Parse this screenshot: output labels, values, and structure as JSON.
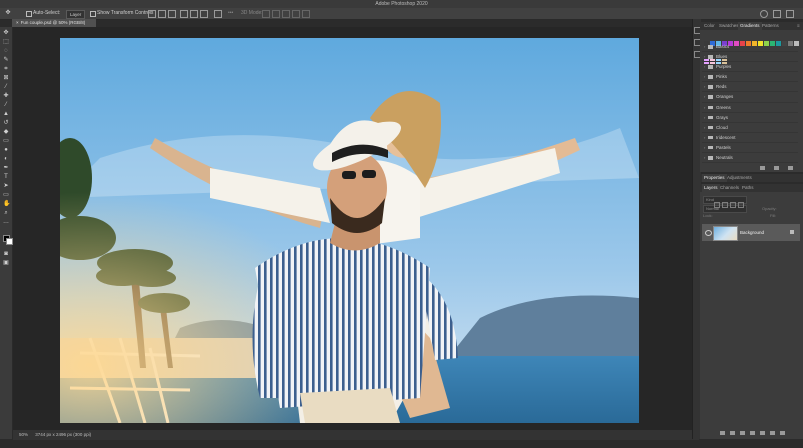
{
  "window": {
    "title": "Adobe Photoshop 2020",
    "traffic_lights": [
      "#ff5f57",
      "#febc2e",
      "#28c840"
    ]
  },
  "options_bar": {
    "auto_select_label": "Auto-Select:",
    "auto_select_value": "Layer",
    "transform_controls_label": "Show Transform Controls",
    "mode_3d_label": "3D Mode:"
  },
  "document": {
    "tab_label": "Fun couple.psd @ 50% (RGB/8)",
    "close_glyph": "×"
  },
  "status_bar": {
    "zoom": "50%",
    "doc_info": "3744 px x 2496 px (300 ppi)"
  },
  "swatch_panel": {
    "tabs": [
      "Color",
      "Swatches",
      "Gradients",
      "Patterns"
    ],
    "active_tab": "Gradients",
    "gradient_groups": [
      "Basics",
      "Blues",
      "Purples",
      "Pinks",
      "Reds",
      "Oranges",
      "Greens",
      "Grays",
      "Cloud",
      "Iridescent",
      "Pastels",
      "Neutrals"
    ],
    "preset_colors": [
      "#3a3a3a",
      "#2f6bd6",
      "#5fb6e8",
      "#7b3fd1",
      "#b73ad9",
      "#e04cc2",
      "#e8434a",
      "#f07c2a",
      "#f2b52a",
      "#f2e22a",
      "#8fd34a",
      "#2bb673",
      "#1c9aa0",
      "#444444",
      "#7a7a7a",
      "#bcbcbc",
      "#e3a0ff",
      "#f7c6dd",
      "#9ad7ff",
      "#d9c19a"
    ]
  },
  "properties_panel": {
    "tabs": [
      "Properties",
      "Adjustments"
    ],
    "active_tab": "Properties"
  },
  "layers_panel": {
    "tabs": [
      "Layers",
      "Channels",
      "Paths"
    ],
    "active_tab": "Layers",
    "kind_placeholder": "Kind",
    "blend_mode": "Normal",
    "opacity_label": "Opacity:",
    "lock_label": "Lock:",
    "fill_label": "Fill:",
    "layers": [
      {
        "name": "Background",
        "locked": true,
        "visible": true
      }
    ]
  }
}
